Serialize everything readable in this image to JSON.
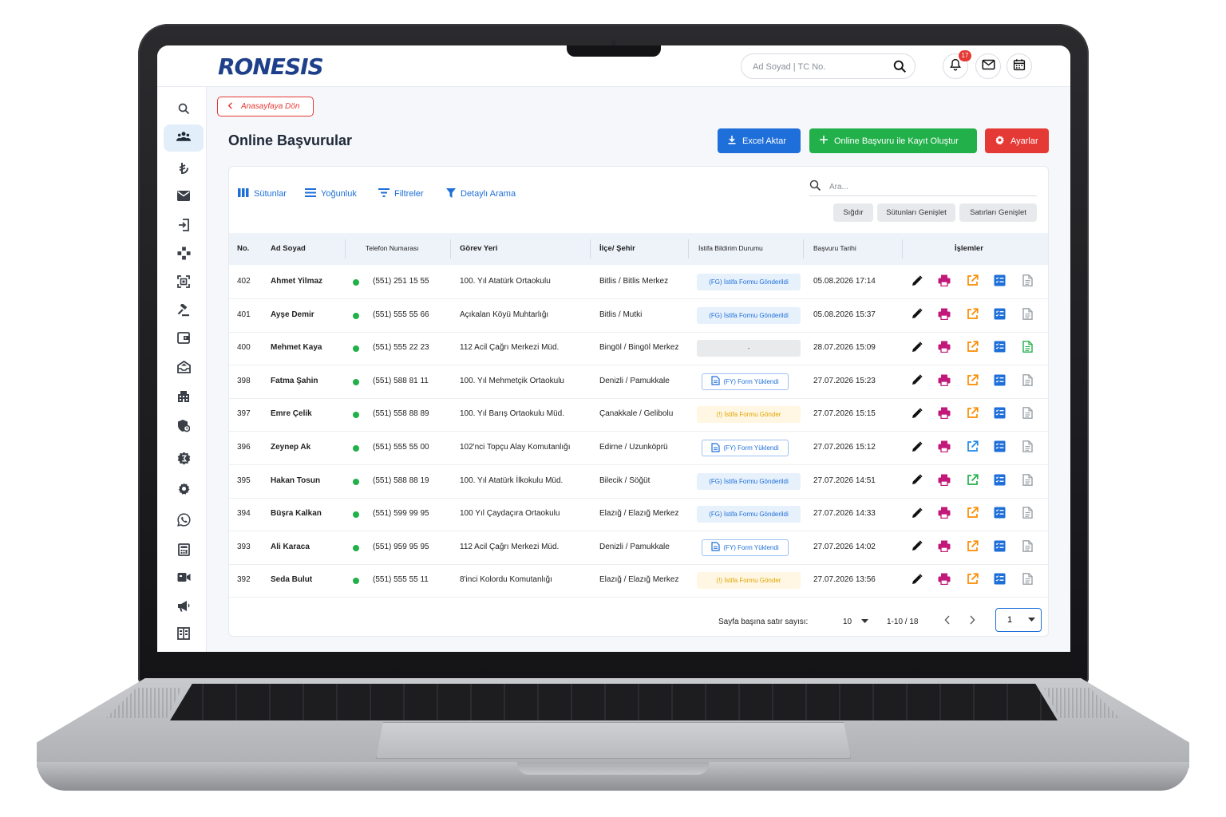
{
  "app": {
    "logo_text": "RONESIS",
    "search_placeholder": "Ad Soyad | TC No.",
    "notification_count": "17"
  },
  "sidebar": {
    "items": [
      {
        "icon": "search-icon",
        "active": false
      },
      {
        "icon": "users-icon",
        "active": true
      },
      {
        "icon": "lira-icon",
        "active": false
      },
      {
        "icon": "mail-icon",
        "active": false
      },
      {
        "icon": "login-door-icon",
        "active": false
      },
      {
        "icon": "network-icon",
        "active": false
      },
      {
        "icon": "scan-icon",
        "active": false
      },
      {
        "icon": "gavel-icon",
        "active": false
      },
      {
        "icon": "wallet-icon",
        "active": false
      },
      {
        "icon": "inbox-icon",
        "active": false
      },
      {
        "icon": "building-icon",
        "active": false
      },
      {
        "icon": "shield-icon",
        "active": false
      },
      {
        "icon": "badge-icon",
        "active": false
      },
      {
        "icon": "gear-icon",
        "active": false
      },
      {
        "icon": "whatsapp-icon",
        "active": false
      },
      {
        "icon": "calculator-icon",
        "active": false
      },
      {
        "icon": "video-icon",
        "active": false
      },
      {
        "icon": "megaphone-icon",
        "active": false
      },
      {
        "icon": "grid-building-icon",
        "active": false
      }
    ]
  },
  "page": {
    "back_label": "Anasayfaya Dön",
    "title": "Online Başvurular",
    "buttons": {
      "excel": "Excel Aktar",
      "create": "Online Başvuru ile Kayıt Oluştur",
      "settings": "Ayarlar"
    }
  },
  "toolbar": {
    "columns": "Sütunlar",
    "density": "Yoğunluk",
    "filters": "Filtreler",
    "detailed_search": "Detaylı Arama",
    "search_placeholder": "Ara...",
    "chip_fit": "Sığdır",
    "chip_expand_cols": "Sütunları Genişlet",
    "chip_expand_rows": "Satırları Genişlet"
  },
  "table": {
    "headers": {
      "no": "No.",
      "name": "Ad Soyad",
      "phone": "Telefon Numarası",
      "workplace": "Görev Yeri",
      "location": "İlçe/ Şehir",
      "resign_status": "İstifa Bildirim Durumu",
      "date": "Başvuru Tarihi",
      "actions": "İşlemler"
    },
    "rows": [
      {
        "no": "402",
        "name": "Ahmet Yilmaz",
        "phone": "(551) 251 15 55",
        "workplace": "100. Yıl Atatürk Ortaokulu",
        "location": "Bitlis / Bitlis Merkez",
        "status": "(FG) İstifa Formu Gönderildi",
        "status_type": "fg",
        "date": "05.08.2026 17:14",
        "edit_color": "#fb8c00",
        "doc_color": "#9aa0a6"
      },
      {
        "no": "401",
        "name": "Ayşe Demir",
        "phone": "(551) 555 55 66",
        "workplace": "Açıkalan Köyü Muhtarlığı",
        "location": "Bitlis / Mutki",
        "status": "(FG) İstifa Formu Gönderildi",
        "status_type": "fg",
        "date": "05.08.2026 15:37",
        "edit_color": "#fb8c00",
        "doc_color": "#9aa0a6"
      },
      {
        "no": "400",
        "name": "Mehmet Kaya",
        "phone": "(551) 555 22 23",
        "workplace": "112 Acil Çağrı Merkezi Müd.",
        "location": "Bingöl / Bingöl Merkez",
        "status": "-",
        "status_type": "none",
        "date": "28.07.2026 15:09",
        "edit_color": "#fb8c00",
        "doc_color": "#22b04a"
      },
      {
        "no": "398",
        "name": "Fatma Şahin",
        "phone": "(551) 588 81 11",
        "workplace": "100. Yıl Mehmetçik Ortaokulu",
        "location": "Denizli / Pamukkale",
        "status": "(FY) Form Yüklendi",
        "status_type": "fy",
        "date": "27.07.2026 15:23",
        "edit_color": "#fb8c00",
        "doc_color": "#9aa0a6"
      },
      {
        "no": "397",
        "name": "Emre Çelik",
        "phone": "(551) 558 88 89",
        "workplace": "100. Yıl Barış Ortaokulu Müd.",
        "location": "Çanakkale / Gelibolu",
        "status": "(!) İstifa Formu Gönder",
        "status_type": "gonder",
        "date": "27.07.2026 15:15",
        "edit_color": "#fb8c00",
        "doc_color": "#9aa0a6"
      },
      {
        "no": "396",
        "name": "Zeynep Ak",
        "phone": "(551) 555 55 00",
        "workplace": "102'nci Topçu Alay Komutanlığı",
        "location": "Edirne / Uzunköprü",
        "status": "(FY) Form Yüklendi",
        "status_type": "fy",
        "date": "27.07.2026 15:12",
        "edit_color": "#1e88e5",
        "doc_color": "#9aa0a6"
      },
      {
        "no": "395",
        "name": "Hakan Tosun",
        "phone": "(551) 588 88 19",
        "workplace": "100. Yıl Atatürk İlkokulu Müd.",
        "location": "Bilecik / Söğüt",
        "status": "(FG) İstifa Formu Gönderildi",
        "status_type": "fg",
        "date": "27.07.2026 14:51",
        "edit_color": "#22b04a",
        "doc_color": "#9aa0a6"
      },
      {
        "no": "394",
        "name": "Büşra Kalkan",
        "phone": "(551) 599 99 95",
        "workplace": "100 Yıl Çaydaçıra Ortaokulu",
        "location": "Elazığ / Elazığ Merkez",
        "status": "(FG) İstifa Formu Gönderildi",
        "status_type": "fg",
        "date": "27.07.2026 14:33",
        "edit_color": "#fb8c00",
        "doc_color": "#9aa0a6"
      },
      {
        "no": "393",
        "name": "Ali Karaca",
        "phone": "(551) 959 95 95",
        "workplace": "112 Acil Çağrı Merkezi Müd.",
        "location": "Denizli / Pamukkale",
        "status": "(FY) Form Yüklendi",
        "status_type": "fy",
        "date": "27.07.2026 14:02",
        "edit_color": "#fb8c00",
        "doc_color": "#9aa0a6"
      },
      {
        "no": "392",
        "name": "Seda Bulut",
        "phone": "(551) 555 55 11",
        "workplace": "8'inci Kolordu Komutanlığı",
        "location": "Elazığ / Elazığ Merkez",
        "status": "(!) İstifa Formu Gönder",
        "status_type": "gonder",
        "date": "27.07.2026 13:56",
        "edit_color": "#fb8c00",
        "doc_color": "#9aa0a6"
      }
    ]
  },
  "pagination": {
    "rows_per_page_label": "Sayfa başına satır sayısı:",
    "rows_per_page": "10",
    "range": "1-10 / 18",
    "page": "1"
  }
}
